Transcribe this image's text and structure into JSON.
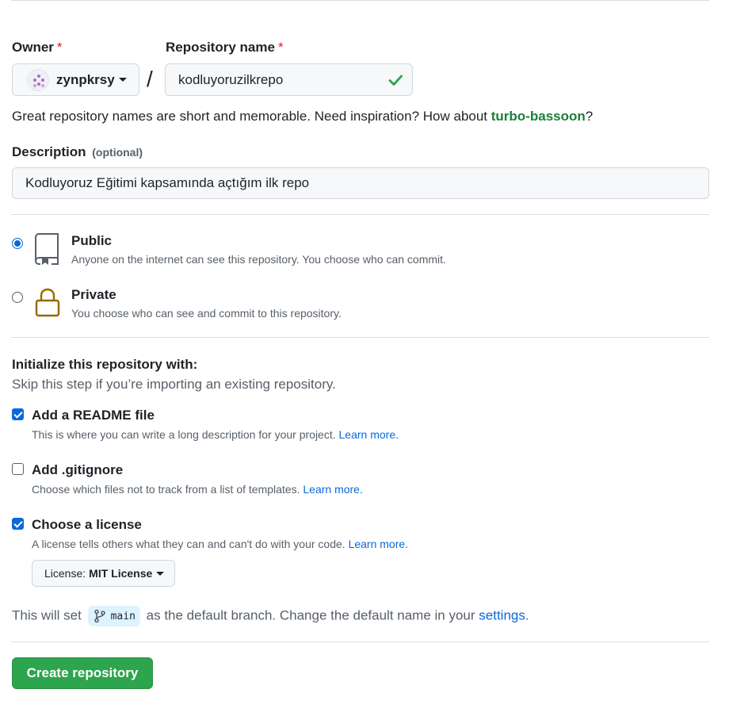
{
  "owner": {
    "label": "Owner",
    "required_mark": "*",
    "value": "zynpkrsy"
  },
  "repo_name": {
    "label": "Repository name",
    "required_mark": "*",
    "separator": "/",
    "value": "kodluyoruzilkrepo"
  },
  "hint": {
    "prefix": "Great repository names are short and memorable. Need inspiration? How about ",
    "suggestion": "turbo-bassoon",
    "suffix": "?"
  },
  "description": {
    "label": "Description",
    "optional": "(optional)",
    "value": "Kodluyoruz Eğitimi kapsamında açtığım ilk repo"
  },
  "visibility": {
    "selected": "public",
    "public": {
      "title": "Public",
      "desc": "Anyone on the internet can see this repository. You choose who can commit."
    },
    "private": {
      "title": "Private",
      "desc": "You choose who can see and commit to this repository."
    }
  },
  "initialize": {
    "heading": "Initialize this repository with:",
    "subheading": "Skip this step if you’re importing an existing repository.",
    "readme": {
      "title": "Add a README file",
      "checked": true,
      "desc": "This is where you can write a long description for your project.",
      "link": "Learn more."
    },
    "gitignore": {
      "title": "Add .gitignore",
      "checked": false,
      "desc": "Choose which files not to track from a list of templates.",
      "link": "Learn more."
    },
    "license": {
      "title": "Choose a license",
      "checked": true,
      "desc": "A license tells others what they can and can't do with your code.",
      "link": "Learn more.",
      "button_prefix": "License:",
      "button_value": "MIT License"
    }
  },
  "branch": {
    "prefix": "This will set",
    "name": "main",
    "middle": "as the default branch. Change the default name in your",
    "link": "settings",
    "suffix": "."
  },
  "create_button": "Create repository",
  "colors": {
    "accent": "#0969da",
    "success": "#2da44e",
    "suggestion": "#1a7f37",
    "required": "#cf222e",
    "lock": "#9a6700"
  }
}
